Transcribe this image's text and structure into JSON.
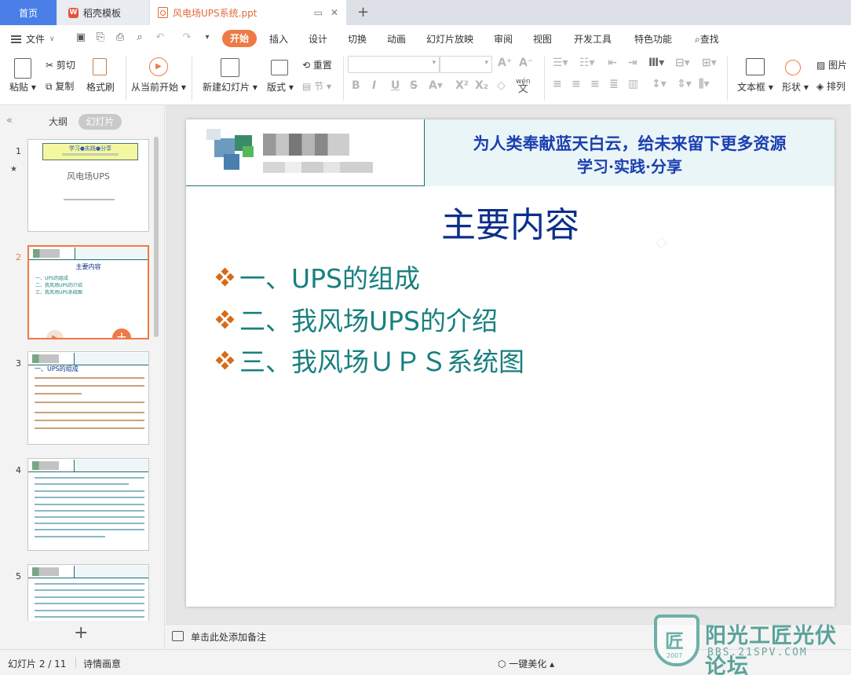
{
  "tabs": {
    "home": "首页",
    "template": "稻壳模板",
    "document": "风电场UPS系统.ppt"
  },
  "menu": {
    "file": "文件",
    "ribbon_tabs": [
      "开始",
      "插入",
      "设计",
      "切换",
      "动画",
      "幻灯片放映",
      "审阅",
      "视图",
      "开发工具",
      "特色功能"
    ],
    "search": "查找"
  },
  "ribbon": {
    "paste": "粘贴",
    "cut": "剪切",
    "copy": "复制",
    "format_painter": "格式刷",
    "play_from_current": "从当前开始",
    "new_slide": "新建幻灯片",
    "layout": "版式",
    "reset": "重置",
    "section": "节",
    "text_box": "文本框",
    "shape": "形状",
    "picture": "图片",
    "arrange": "排列",
    "wen": "wén",
    "wen_char": "文"
  },
  "left_panel": {
    "outline": "大纲",
    "slides": "幻灯片",
    "thumbnails": [
      {
        "num": "1",
        "star": "★",
        "banner": "学习●实践●分享",
        "title": "风电场UPS"
      },
      {
        "num": "2",
        "title": "主要内容",
        "items": [
          "一、UPS的组成",
          "二、我风场UPS的介绍",
          "三、我风场UPS系统图"
        ]
      },
      {
        "num": "3",
        "title": "一、UPS的组成"
      },
      {
        "num": "4"
      },
      {
        "num": "5"
      }
    ]
  },
  "slide": {
    "banner_line1": "为人类奉献蓝天白云，给未来留下更多资源",
    "banner_line2": "学习·实践·分享",
    "title": "主要内容",
    "bullets": [
      "一、UPS的组成",
      "二、我风场UPS的介绍",
      "三、我风场ＵＰＳ系统图"
    ]
  },
  "notes": {
    "placeholder": "单击此处添加备注"
  },
  "status": {
    "slide_counter": "幻灯片 2 / 11",
    "theme": "诗情画意",
    "beautify": "一键美化"
  },
  "brand": {
    "title": "阳光工匠光伏论坛",
    "url": "BBS.21SPV.COM",
    "year": "2007",
    "seal": "匠"
  },
  "colors": {
    "accent": "#ee7a45",
    "home_tab": "#4a7fe8",
    "slide_title": "#0c2f8a",
    "bullet_text": "#18807f",
    "bullet_marker": "#d96a16",
    "banner_text": "#1b3fb0"
  }
}
